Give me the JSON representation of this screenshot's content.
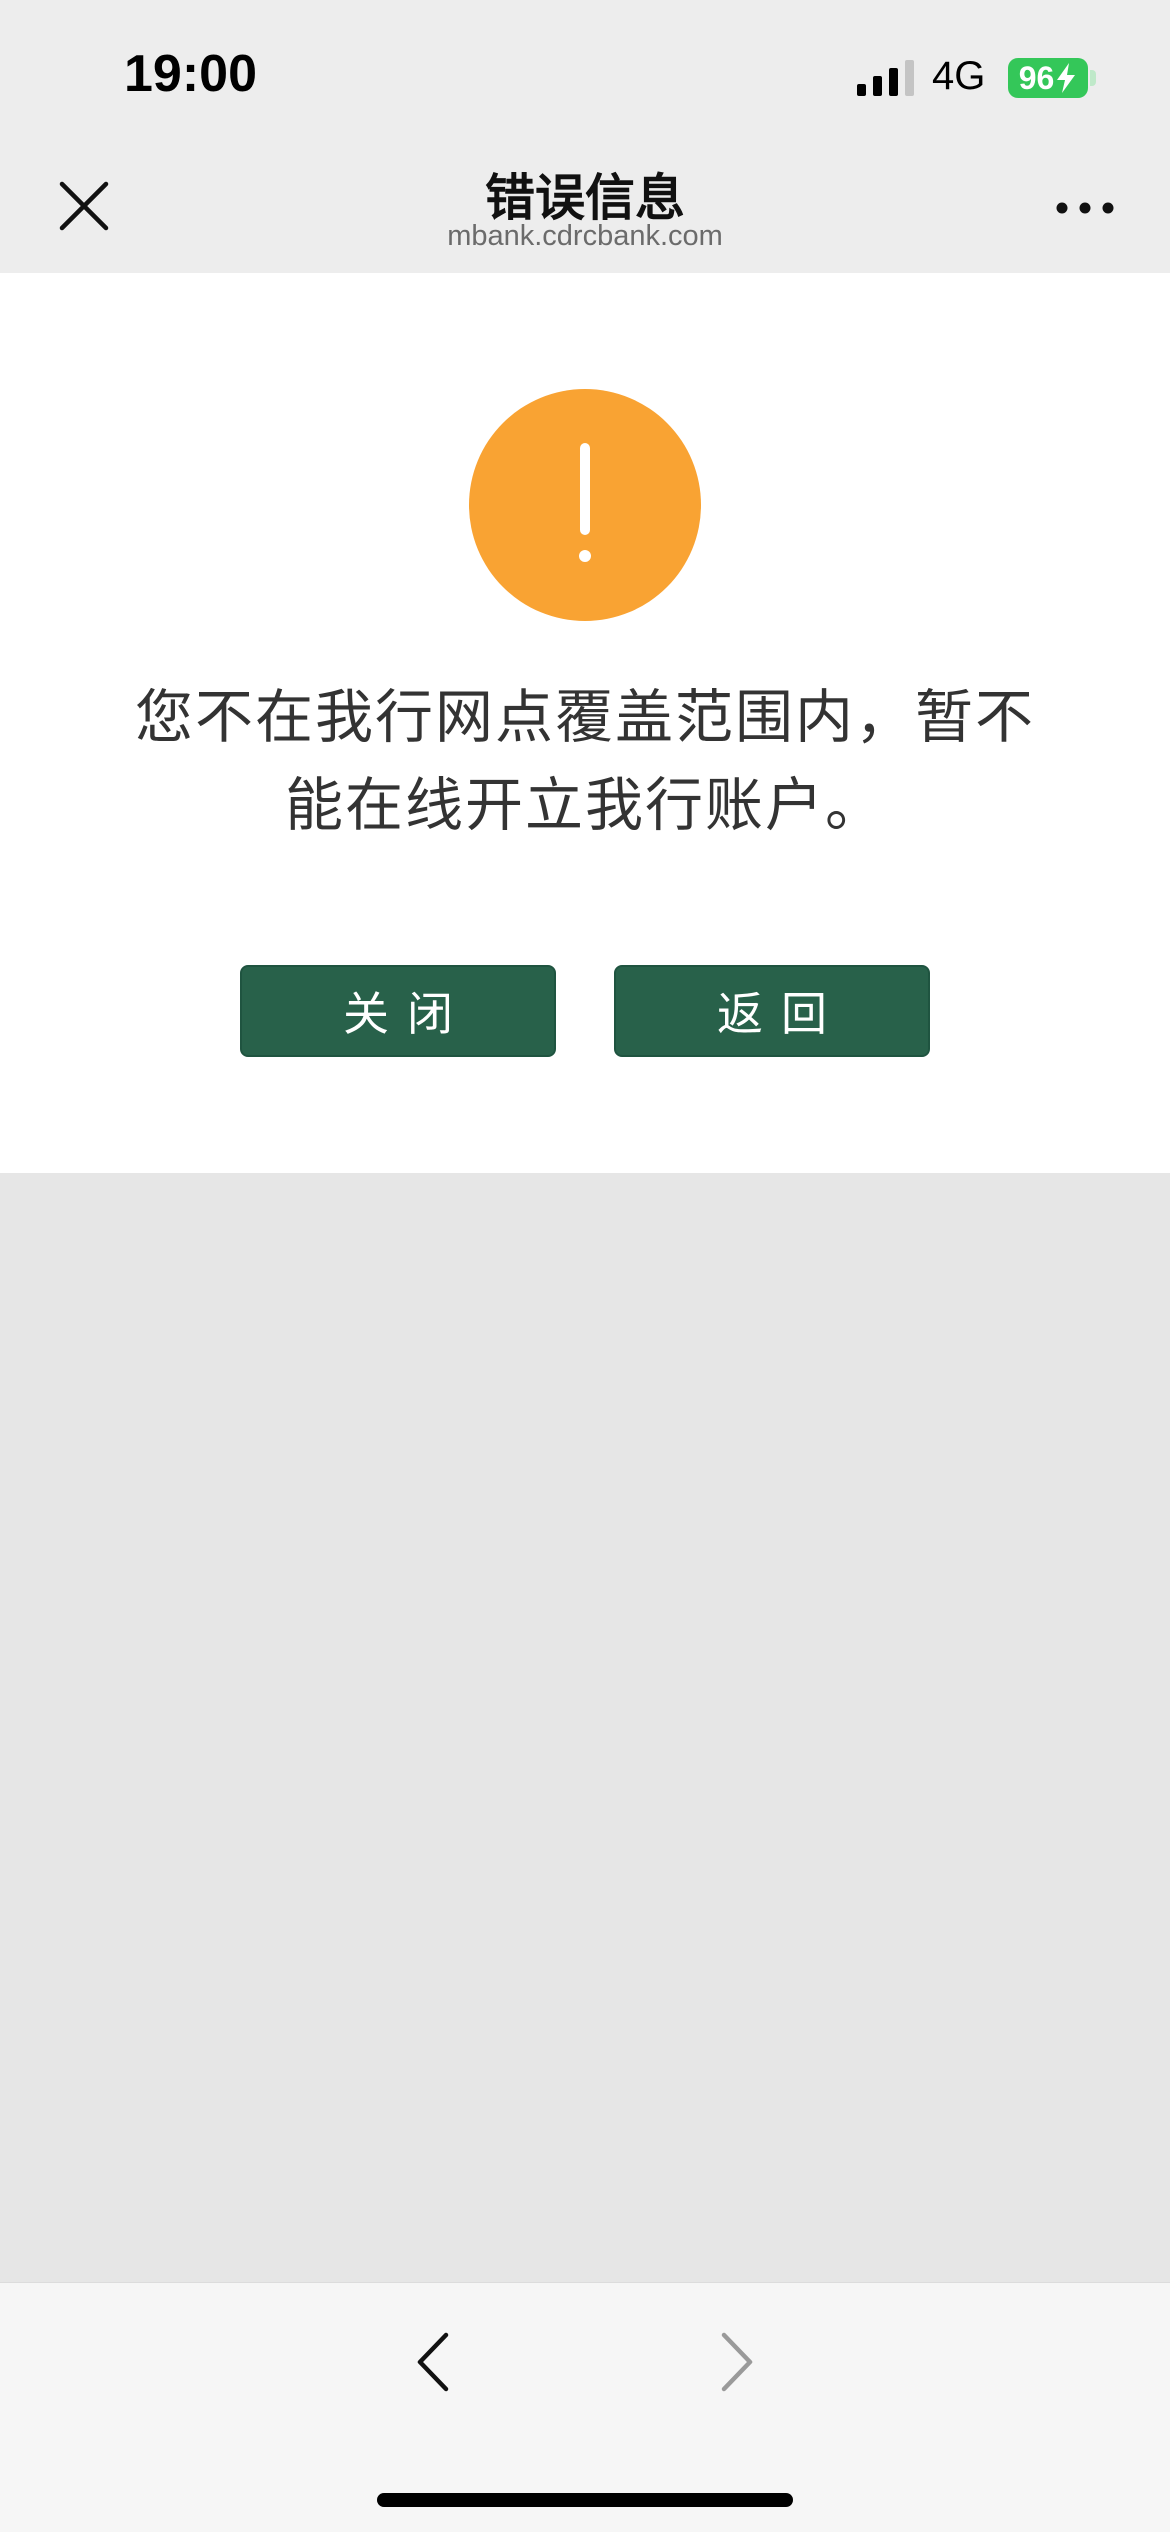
{
  "status_bar": {
    "time": "19:00",
    "network": "4G",
    "battery": "96",
    "icons": [
      "signal-icon",
      "battery-charging-icon"
    ]
  },
  "nav_bar": {
    "title": "错误信息",
    "subtitle": "mbank.cdrcbank.com",
    "icons": [
      "close-icon",
      "more-icon"
    ]
  },
  "content": {
    "icon": "warning-icon",
    "message": "您不在我行网点覆盖范围内，暂不能在线开立我行账户。",
    "buttons": {
      "close_label": "关闭",
      "back_label": "返回"
    }
  },
  "bottom_bar": {
    "icons": [
      "back-arrow-icon",
      "forward-arrow-icon"
    ]
  },
  "colors": {
    "warning_orange": "#f9a333",
    "button_green": "#28614a",
    "battery_green": "#34c759",
    "header_bg": "#ededed",
    "page_bg": "#e6e6e6"
  }
}
